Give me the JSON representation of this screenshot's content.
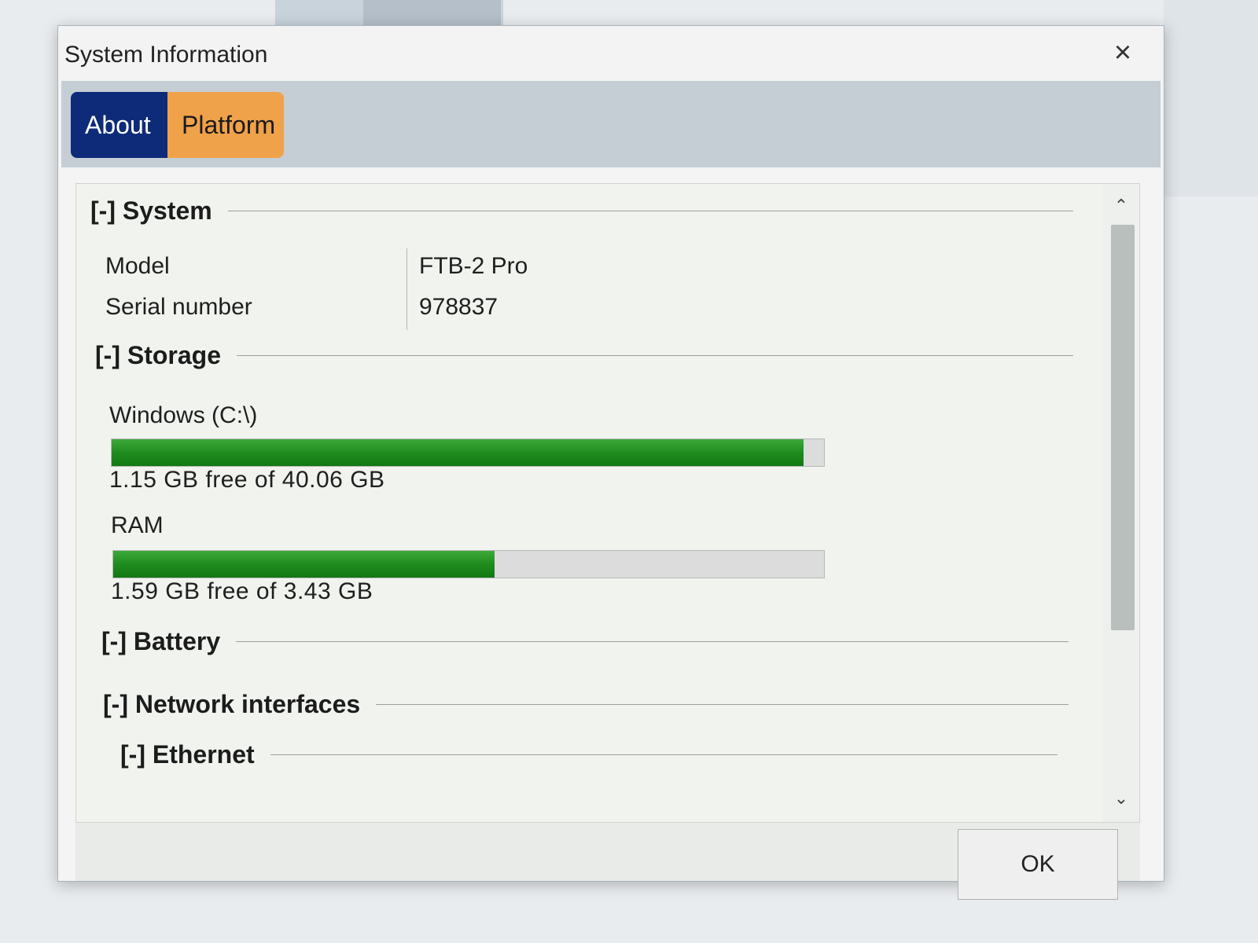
{
  "window": {
    "title": "System Information",
    "close_glyph": "×",
    "close_icon": "close-icon"
  },
  "tabs": [
    {
      "label": "About",
      "selected": true,
      "color": "#0d2b78"
    },
    {
      "label": "Platform",
      "selected": false,
      "color": "#f0a24a"
    }
  ],
  "sections": {
    "system": {
      "header": "[-] System",
      "rows": [
        {
          "label": "Model",
          "value": "FTB-2 Pro"
        },
        {
          "label": "Serial number",
          "value": "978837"
        }
      ]
    },
    "storage": {
      "header": "[-] Storage",
      "drives": [
        {
          "name": "Windows (C:\\)",
          "info": "1.15 GB free of 40.06 GB",
          "free_gb": 1.15,
          "total_gb": 40.06
        },
        {
          "name": "RAM",
          "info": "1.59 GB free of 3.43 GB",
          "free_gb": 1.59,
          "total_gb": 3.43
        }
      ]
    },
    "battery": {
      "header": "[-] Battery"
    },
    "network": {
      "header": "[-] Network interfaces"
    },
    "ethernet": {
      "header": "[-] Ethernet"
    }
  },
  "scrollbar": {
    "up_glyph": "⌃",
    "down_glyph": "⌄"
  },
  "footer": {
    "ok_label": "OK"
  },
  "colors": {
    "bar_fill": "#1f8c1f",
    "bar_track": "#dcdcdc"
  }
}
